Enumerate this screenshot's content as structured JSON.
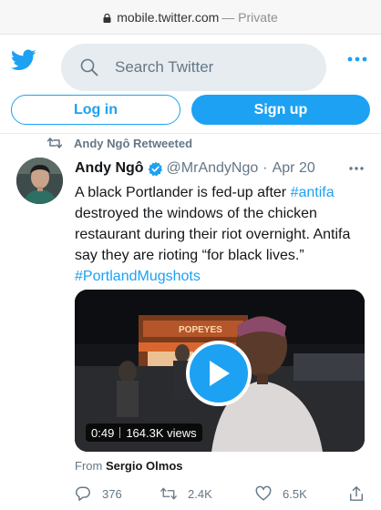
{
  "browser": {
    "host": "mobile.twitter.com",
    "mode": "— Private"
  },
  "header": {
    "search_placeholder": "Search Twitter"
  },
  "auth": {
    "login_label": "Log in",
    "signup_label": "Sign up"
  },
  "tweet": {
    "retweeted_by": "Andy Ngô Retweeted",
    "author_name": "Andy Ngô",
    "handle": "@MrAndyNgo",
    "separator": "·",
    "date": "Apr 20",
    "text_part1": "A black Portlander is fed-up after ",
    "hashtag1": "#antifa",
    "text_part2": " destroyed the windows of the chicken restaurant during their riot overnight. Antifa say they are rioting “for black lives.” ",
    "hashtag2": "#PortlandMugshots",
    "video_duration": "0:49",
    "video_views": "164.3K views",
    "storefront_sign": "POPEYES",
    "from_label": "From",
    "from_name": "Sergio Olmos",
    "replies": "376",
    "retweets": "2.4K",
    "likes": "6.5K"
  },
  "colors": {
    "accent": "#1da1f2",
    "muted": "#657786",
    "text": "#14171a"
  },
  "icons": [
    "lock-icon",
    "twitter-bird-icon",
    "search-icon",
    "more-icon",
    "retweet-icon",
    "verified-icon",
    "play-icon",
    "reply-icon",
    "like-icon",
    "share-icon"
  ]
}
